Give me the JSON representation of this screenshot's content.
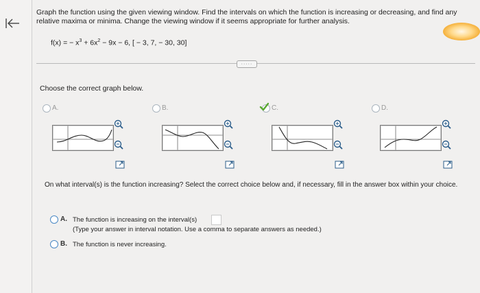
{
  "question": {
    "instruction": "Graph the function using the given viewing window. Find the intervals on which the function is increasing or decreasing, and find any relative maxima or minima. Change the viewing window if it seems appropriate for further analysis.",
    "function_prefix": "f(x) = − x",
    "function_exp1": "3",
    "function_mid": " + 6x",
    "function_exp2": "2",
    "function_suffix": " − 9x − 6, [ − 3, 7, − 30, 30]"
  },
  "more_label": "·····",
  "prompt": "Choose the correct graph below.",
  "choices": [
    {
      "label": "A.",
      "selected": false
    },
    {
      "label": "B.",
      "selected": false
    },
    {
      "label": "C.",
      "selected": true
    },
    {
      "label": "D.",
      "selected": false
    }
  ],
  "sub_question": "On what interval(s) is the function increasing? Select the correct choice below and, if necessary, fill in the answer box within your choice.",
  "answers": {
    "a_letter": "A.",
    "a_text": "The function is increasing on the interval(s)",
    "a_note": "(Type your answer in interval notation. Use a comma to separate answers as needed.)",
    "b_letter": "B.",
    "b_text": "The function is never increasing."
  },
  "colors": {
    "radio_border": "#4a88c4",
    "check": "#5aa832",
    "accent": "#f5b13c"
  }
}
